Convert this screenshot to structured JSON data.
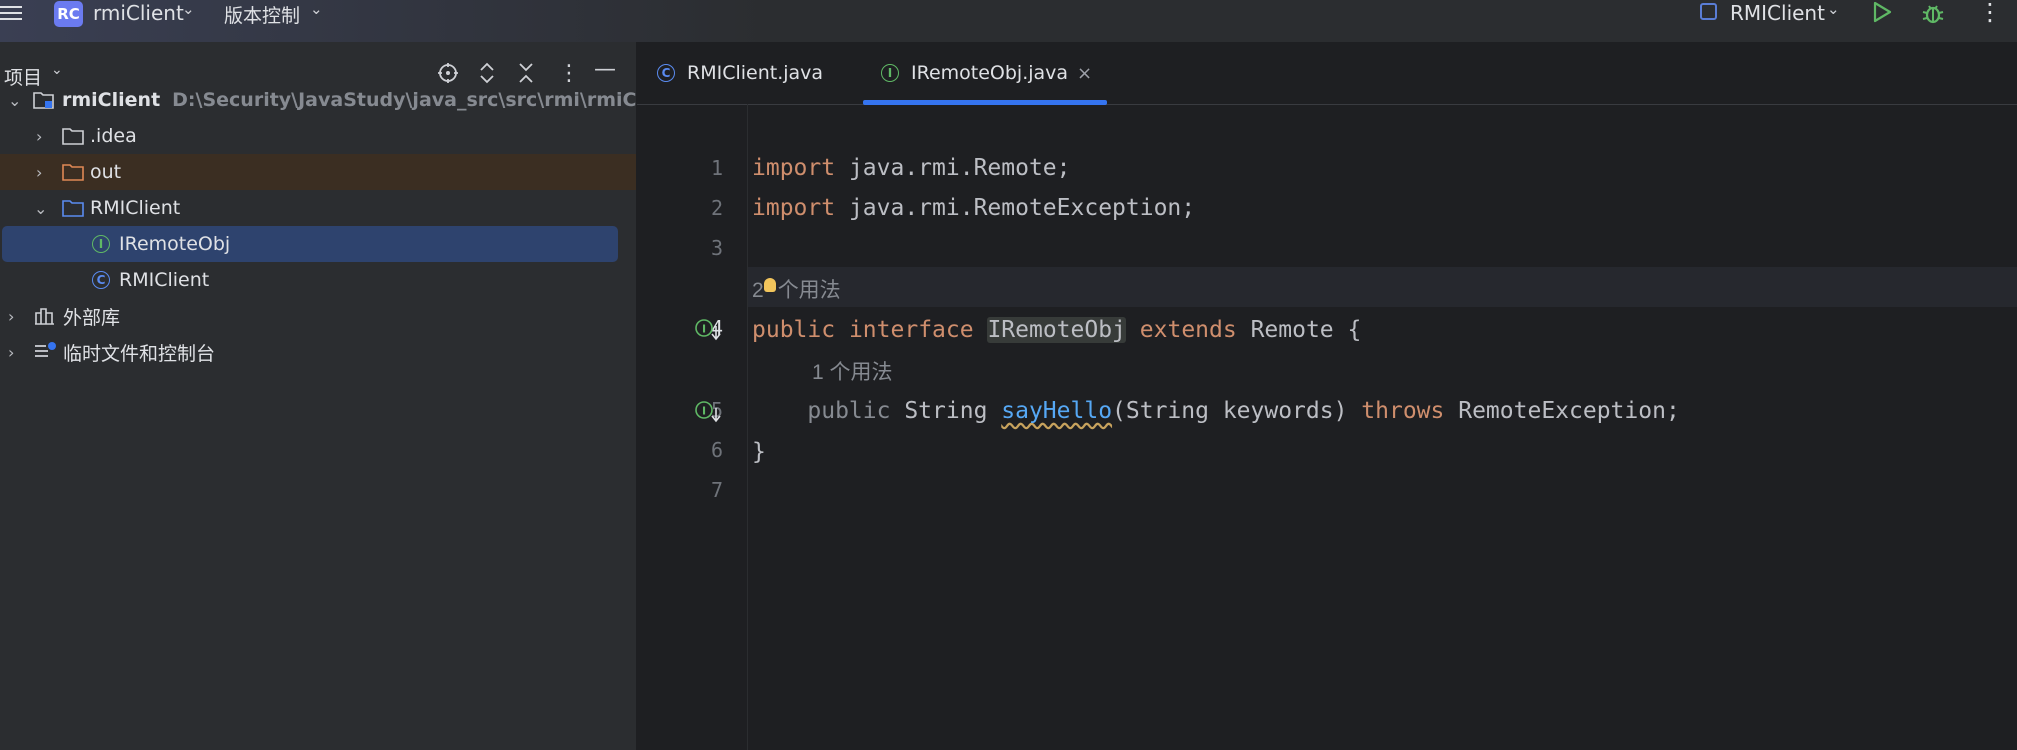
{
  "titlebar": {
    "project_badge": "RC",
    "project_name": "rmiClient",
    "vcs_label": "版本控制",
    "run_config": "RMIClient"
  },
  "project_panel": {
    "title": "项目",
    "tree": [
      {
        "label": "rmiClient",
        "path": "D:\\Security\\JavaStudy\\java_src\\src\\rmi\\rmiClient"
      },
      {
        "label": ".idea"
      },
      {
        "label": "out"
      },
      {
        "label": "RMIClient"
      },
      {
        "label": "IRemoteObj",
        "badge": "I"
      },
      {
        "label": "RMIClient",
        "badge": "C"
      },
      {
        "label": "外部库"
      },
      {
        "label": "临时文件和控制台"
      }
    ]
  },
  "editor": {
    "tabs": [
      {
        "label": "RMIClient.java",
        "badge": "C"
      },
      {
        "label": "IRemoteObj.java",
        "badge": "I",
        "active": true
      }
    ],
    "line_numbers": [
      "1",
      "2",
      "3",
      "4",
      "5",
      "6",
      "7"
    ],
    "hints": {
      "usages_interface_num": "2",
      "usages_interface_text": "个用法",
      "usages_method": "1 个用法"
    },
    "code": {
      "l1_kw": "import",
      "l1_rest": " java.rmi.Remote;",
      "l2_kw": "import",
      "l2_rest": " java.rmi.RemoteException;",
      "l4_kw1": "public",
      "l4_kw2": "interface",
      "l4_name": "IRemoteObj",
      "l4_kw3": "extends",
      "l4_rest": " Remote {",
      "l5_mod": "public",
      "l5_type": " String ",
      "l5_method": "sayHello",
      "l5_params": "(String keywords) ",
      "l5_kw": "throws",
      "l5_rest": " RemoteException;",
      "l6": "}"
    }
  },
  "colors": {
    "keyword": "#cf8e6d",
    "method": "#56a8f5",
    "interface_badge": "#5fb865",
    "class_badge": "#5a8bf0",
    "accent": "#3574f0"
  }
}
